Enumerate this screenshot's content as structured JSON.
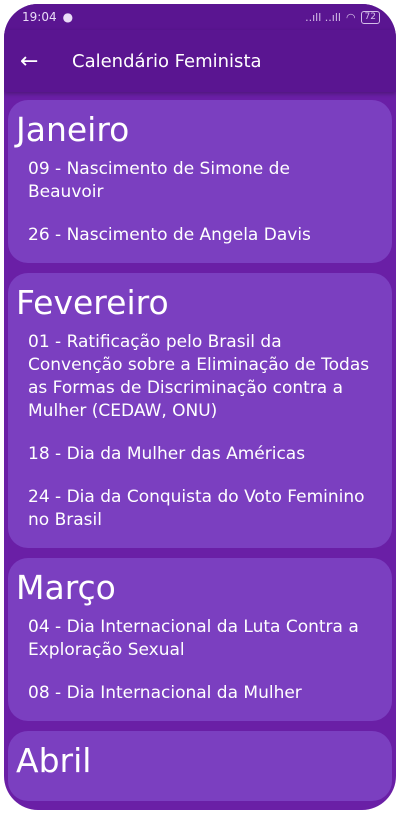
{
  "status": {
    "time": "19:04",
    "signal": "..ıll ..ıll",
    "battery": "72"
  },
  "appbar": {
    "title": "Calendário Feminista"
  },
  "months": [
    {
      "name": "Janeiro",
      "events": [
        "09 - Nascimento de Simone de Beauvoir",
        "26 - Nascimento de Angela Davis"
      ]
    },
    {
      "name": "Fevereiro",
      "events": [
        "01 - Ratificação pelo Brasil da Convenção sobre a Eliminação de Todas as Formas de Discriminação contra a Mulher (CEDAW, ONU)",
        "18 - Dia da Mulher das Américas",
        "24 - Dia da Conquista do Voto Feminino no Brasil"
      ]
    },
    {
      "name": "Março",
      "events": [
        "04 - Dia Internacional da Luta Contra a Exploração Sexual",
        "08 - Dia Internacional da Mulher"
      ]
    },
    {
      "name": "Abril",
      "events": []
    }
  ],
  "colors": {
    "appbar": "#5a1591",
    "background": "#6a1fa6",
    "card": "#7b3fc0",
    "text": "#ffffff"
  }
}
